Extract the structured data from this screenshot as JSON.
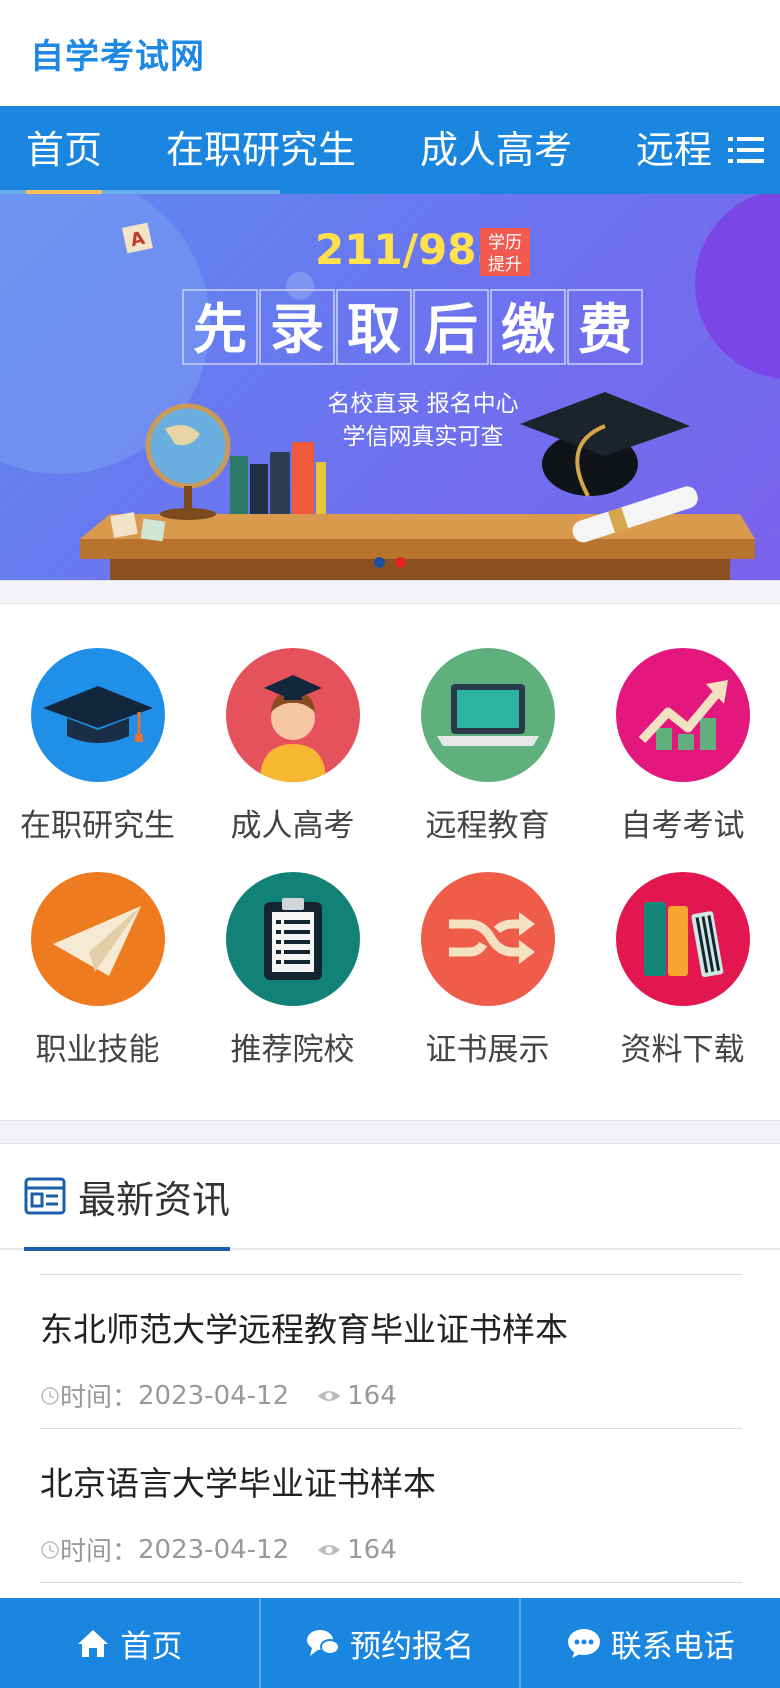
{
  "header": {
    "logo": "自学考试网"
  },
  "nav": {
    "items": [
      "首页",
      "在职研究生",
      "成人高考",
      "远程"
    ],
    "active_index": 0
  },
  "banner": {
    "tag_number": "211/985",
    "tag_badge_line1": "学历",
    "tag_badge_line2": "提升",
    "headline_chars": [
      "先",
      "录",
      "取",
      "后",
      "缴",
      "费"
    ],
    "sub_line1": "名校直录   报名中心",
    "sub_line2": "学信网真实可查",
    "slide_count": 2,
    "active_slide": 2
  },
  "categories": [
    {
      "label": "在职研究生",
      "icon": "graduation-cap-icon",
      "color": "#1f8fe8"
    },
    {
      "label": "成人高考",
      "icon": "student-avatar-icon",
      "color": "#e5525c"
    },
    {
      "label": "远程教育",
      "icon": "laptop-icon",
      "color": "#5fb07d"
    },
    {
      "label": "自考考试",
      "icon": "growth-chart-icon",
      "color": "#e3177d"
    },
    {
      "label": "职业技能",
      "icon": "paper-plane-icon",
      "color": "#ee7b1f"
    },
    {
      "label": "推荐院校",
      "icon": "clipboard-icon",
      "color": "#128176"
    },
    {
      "label": "证书展示",
      "icon": "shuffle-icon",
      "color": "#ef5d4a"
    },
    {
      "label": "资料下载",
      "icon": "books-icon",
      "color": "#e3174f"
    }
  ],
  "news": {
    "title": "最新资讯",
    "time_label": "时间：",
    "items": [
      {
        "title": "东北师范大学远程教育毕业证书样本",
        "date": "2023-04-12",
        "views": "164"
      },
      {
        "title": "北京语言大学毕业证书样本",
        "date": "2023-04-12",
        "views": "164"
      }
    ]
  },
  "bottom_bar": {
    "home": "首页",
    "signup": "预约报名",
    "phone": "联系电话"
  }
}
